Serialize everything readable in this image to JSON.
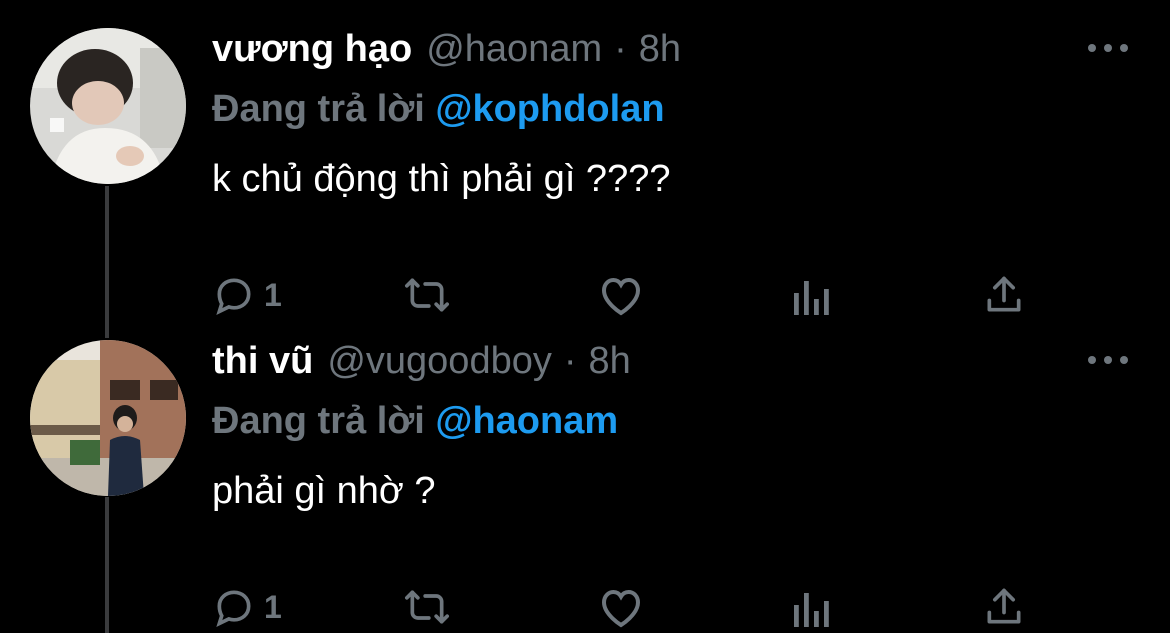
{
  "colors": {
    "background": "#000000",
    "text": "#ffffff",
    "muted": "#6e767d",
    "mention": "#1d9bf0",
    "thread_line": "#3a3b3d"
  },
  "tweets": [
    {
      "name": "vương hạo",
      "handle": "@haonam",
      "separator": "·",
      "time": "8h",
      "replying_prefix": "Đang trả lời",
      "replying_to": "@kophdolan",
      "text": "k chủ động thì phải gì ????",
      "reply_count": "1",
      "icons": [
        "reply-icon",
        "retweet-icon",
        "like-icon",
        "analytics-icon",
        "share-icon",
        "more-icon"
      ]
    },
    {
      "name": "thi vũ",
      "handle": "@vugoodboy",
      "separator": "·",
      "time": "8h",
      "replying_prefix": "Đang trả lời",
      "replying_to": "@haonam",
      "text": "phải gì nhờ ?",
      "reply_count": "1",
      "icons": [
        "reply-icon",
        "retweet-icon",
        "like-icon",
        "analytics-icon",
        "share-icon",
        "more-icon"
      ]
    }
  ]
}
